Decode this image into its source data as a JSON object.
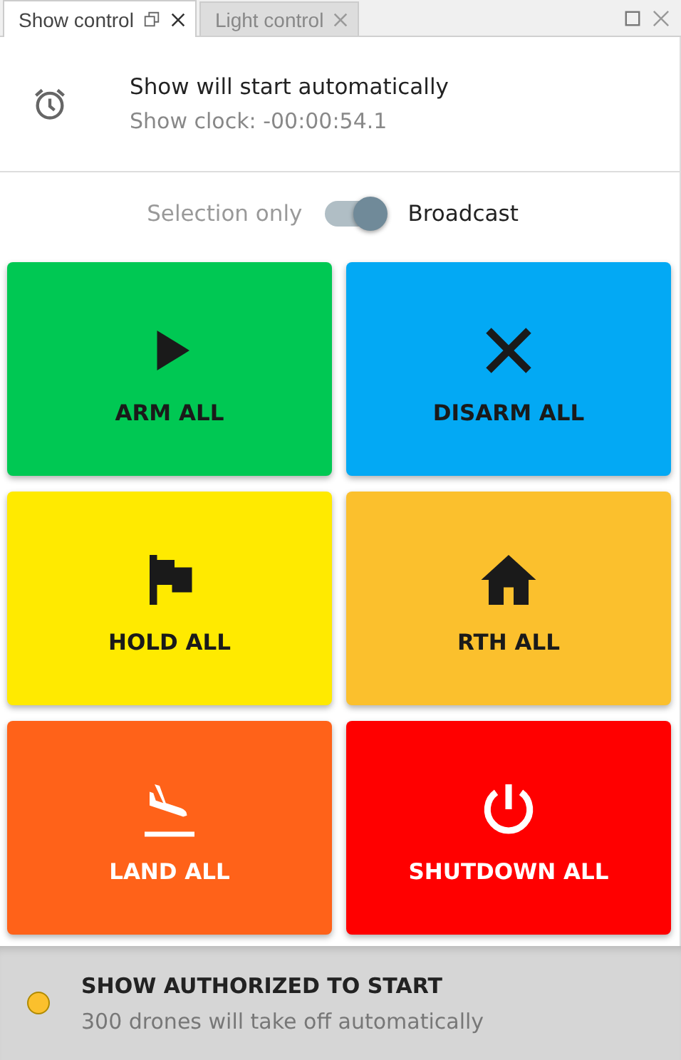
{
  "tabs": [
    {
      "label": "Show control",
      "selected": true
    },
    {
      "label": "Light control",
      "selected": false
    }
  ],
  "clock": {
    "title": "Show will start automatically",
    "subtitle": "Show clock: -00:00:54.1"
  },
  "mode_toggle": {
    "off_label": "Selection only",
    "on_label": "Broadcast",
    "on": true
  },
  "buttons": [
    {
      "label": "ARM ALL",
      "kind": "play",
      "color": "#00c853"
    },
    {
      "label": "DISARM ALL",
      "kind": "cross",
      "color": "#03a9f4"
    },
    {
      "label": "HOLD ALL",
      "kind": "flag",
      "color": "#ffea00"
    },
    {
      "label": "RTH ALL",
      "kind": "home",
      "color": "#fbc02d"
    },
    {
      "label": "LAND ALL",
      "kind": "land",
      "color": "#ff6219"
    },
    {
      "label": "SHUTDOWN ALL",
      "kind": "power",
      "color": "#ff0000"
    }
  ],
  "status": {
    "title": "SHOW AUTHORIZED TO START",
    "message": "300 drones will take off automatically",
    "color": "#fbc02d"
  }
}
